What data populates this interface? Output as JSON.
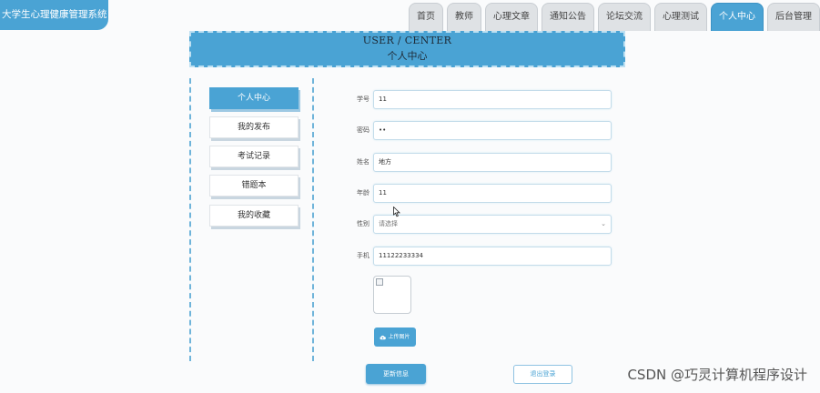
{
  "app": {
    "title": "大学生心理健康管理系统"
  },
  "nav": {
    "items": [
      {
        "label": "首页"
      },
      {
        "label": "教师"
      },
      {
        "label": "心理文章"
      },
      {
        "label": "通知公告"
      },
      {
        "label": "论坛交流"
      },
      {
        "label": "心理测试"
      },
      {
        "label": "个人中心"
      },
      {
        "label": "后台管理"
      }
    ],
    "active": "个人中心"
  },
  "banner": {
    "title_en": "USER / CENTER",
    "title_zh": "个人中心"
  },
  "sidebar": {
    "items": [
      {
        "label": "个人中心"
      },
      {
        "label": "我的发布"
      },
      {
        "label": "考试记录"
      },
      {
        "label": "错题本"
      },
      {
        "label": "我的收藏"
      }
    ],
    "active": "个人中心"
  },
  "form": {
    "student_id": {
      "label": "学号",
      "value": "11"
    },
    "password": {
      "label": "密码",
      "value": "••"
    },
    "name": {
      "label": "姓名",
      "value": "地方"
    },
    "age": {
      "label": "年龄",
      "value": "11"
    },
    "gender": {
      "label": "性别",
      "placeholder": "请选择"
    },
    "phone": {
      "label": "手机",
      "value": "11122233334"
    }
  },
  "buttons": {
    "upload": "上传图片",
    "save": "更新信息",
    "logout": "退出登录"
  },
  "watermark": "CSDN @巧灵计算机程序设计",
  "colors": {
    "accent": "#4aa3d4",
    "nav_inactive": "#dfe2e5"
  },
  "icons": {
    "upload": "cloud-upload-icon",
    "select": "chevron-down-icon"
  }
}
